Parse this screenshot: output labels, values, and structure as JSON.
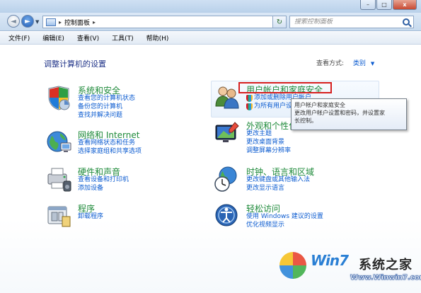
{
  "window": {
    "minimize": "–",
    "maximize": "□",
    "close": "x"
  },
  "address": {
    "breadcrumb": "控制面板",
    "separator": "▸",
    "search_placeholder": "搜索控制面板"
  },
  "menu": [
    "文件(F)",
    "编辑(E)",
    "查看(V)",
    "工具(T)",
    "帮助(H)"
  ],
  "page_title": "调整计算机的设置",
  "view_by": {
    "label": "查看方式:",
    "value": "类别"
  },
  "categories": {
    "system": {
      "title": "系统和安全",
      "links": [
        "查看您的计算机状态",
        "备份您的计算机",
        "查找并解决问题"
      ]
    },
    "network": {
      "title": "网络和 Internet",
      "links": [
        "查看网络状态和任务",
        "选择家庭组和共享选项"
      ]
    },
    "hardware": {
      "title": "硬件和声音",
      "links": [
        "查看设备和打印机",
        "添加设备"
      ]
    },
    "programs": {
      "title": "程序",
      "links": [
        "卸载程序"
      ]
    },
    "users": {
      "title": "用户帐户和家庭安全",
      "links": [
        "添加或删除用户帐户",
        "为所有用户设"
      ]
    },
    "appearance": {
      "title": "外观和个性化",
      "links": [
        "更改主题",
        "更改桌面背景",
        "调整屏幕分辨率"
      ]
    },
    "clock": {
      "title": "时钟、语言和区域",
      "links": [
        "更改键盘或其他输入法",
        "更改显示语言"
      ]
    },
    "ease": {
      "title": "轻松访问",
      "links": [
        "使用 Windows 建议的设置",
        "优化视频显示"
      ]
    }
  },
  "tooltip": [
    "用户帐户和家庭安全",
    "更改用户帐户设置和密码，并设置家",
    "长控制。"
  ],
  "watermark": {
    "brand": "Win7",
    "text": "系统之家",
    "url": "Www.Winwin7.com"
  }
}
